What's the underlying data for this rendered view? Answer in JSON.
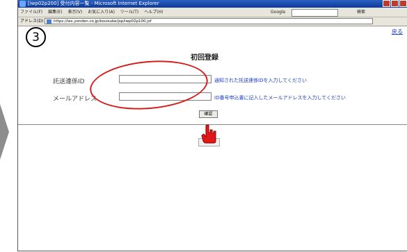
{
  "window": {
    "title": "[iwp02p200] 受付内容一覧 - Microsoft Internet Explorer"
  },
  "toolbar": {
    "menu": [
      "ファイル(F)",
      "編集(E)",
      "表示(V)",
      "お気に入り(A)",
      "ツール(T)",
      "ヘルプ(H)"
    ],
    "google_label": "Google",
    "search_label": "検索"
  },
  "address": {
    "label": "アドレス(D)",
    "url": "https://ies.yonden.co.jp/kouisuke/jsp/iwp02p100.jsf"
  },
  "page": {
    "step_number": "3",
    "back_link": "戻る",
    "heading": "初回登録",
    "fields": [
      {
        "label": "託送連係ID",
        "value": "",
        "hint": "通知された託送連係IDを入力してください"
      },
      {
        "label": "メールアドレス",
        "value": "",
        "hint": "ID番号申込書に記入したメールアドレスを入力してください"
      }
    ],
    "confirm_button": "確認"
  },
  "colors": {
    "annotation": "#d61b1b",
    "link": "#1a3cc8"
  },
  "icons": [
    "ie-logo-icon",
    "page-icon",
    "hand-pointer-icon",
    "arrow-right-icon"
  ]
}
